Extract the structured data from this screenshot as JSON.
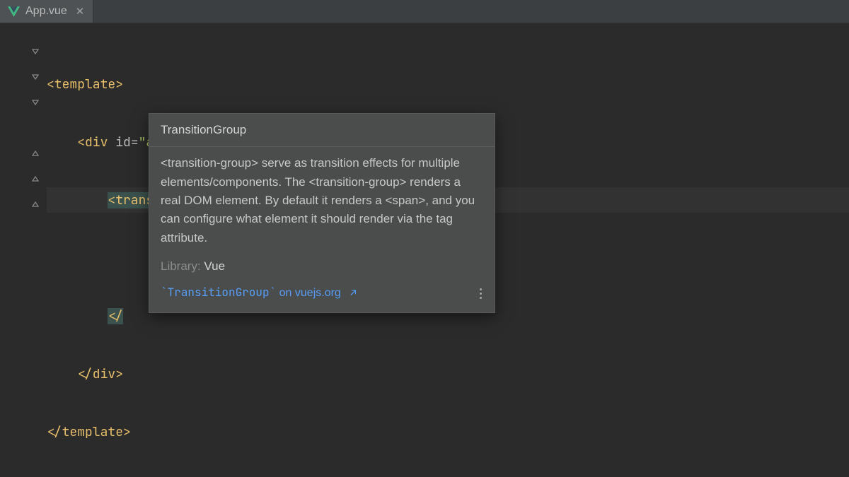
{
  "tab": {
    "filename": "App.vue"
  },
  "code": {
    "l1_tag": "<template>",
    "l2_open": "<div ",
    "l2_attr": "id",
    "l2_eq": "=",
    "l2_val": "\"app\"",
    "l2_close": ">",
    "l3_tag": "<transition-group>",
    "l5_partial": "</",
    "l6_tag": "</div>",
    "l7_tag": "</template>"
  },
  "tooltip": {
    "title": "TransitionGroup",
    "body": "<transition-group> serve as transition effects for multiple elements/components. The <transition-group> renders a real DOM element. By default it renders a <span>, and you can configure what element it should render via the tag attribute.",
    "library_label": "Library:",
    "library_value": "Vue",
    "link_code": "`TransitionGroup`",
    "link_text": " on vuejs.org"
  }
}
